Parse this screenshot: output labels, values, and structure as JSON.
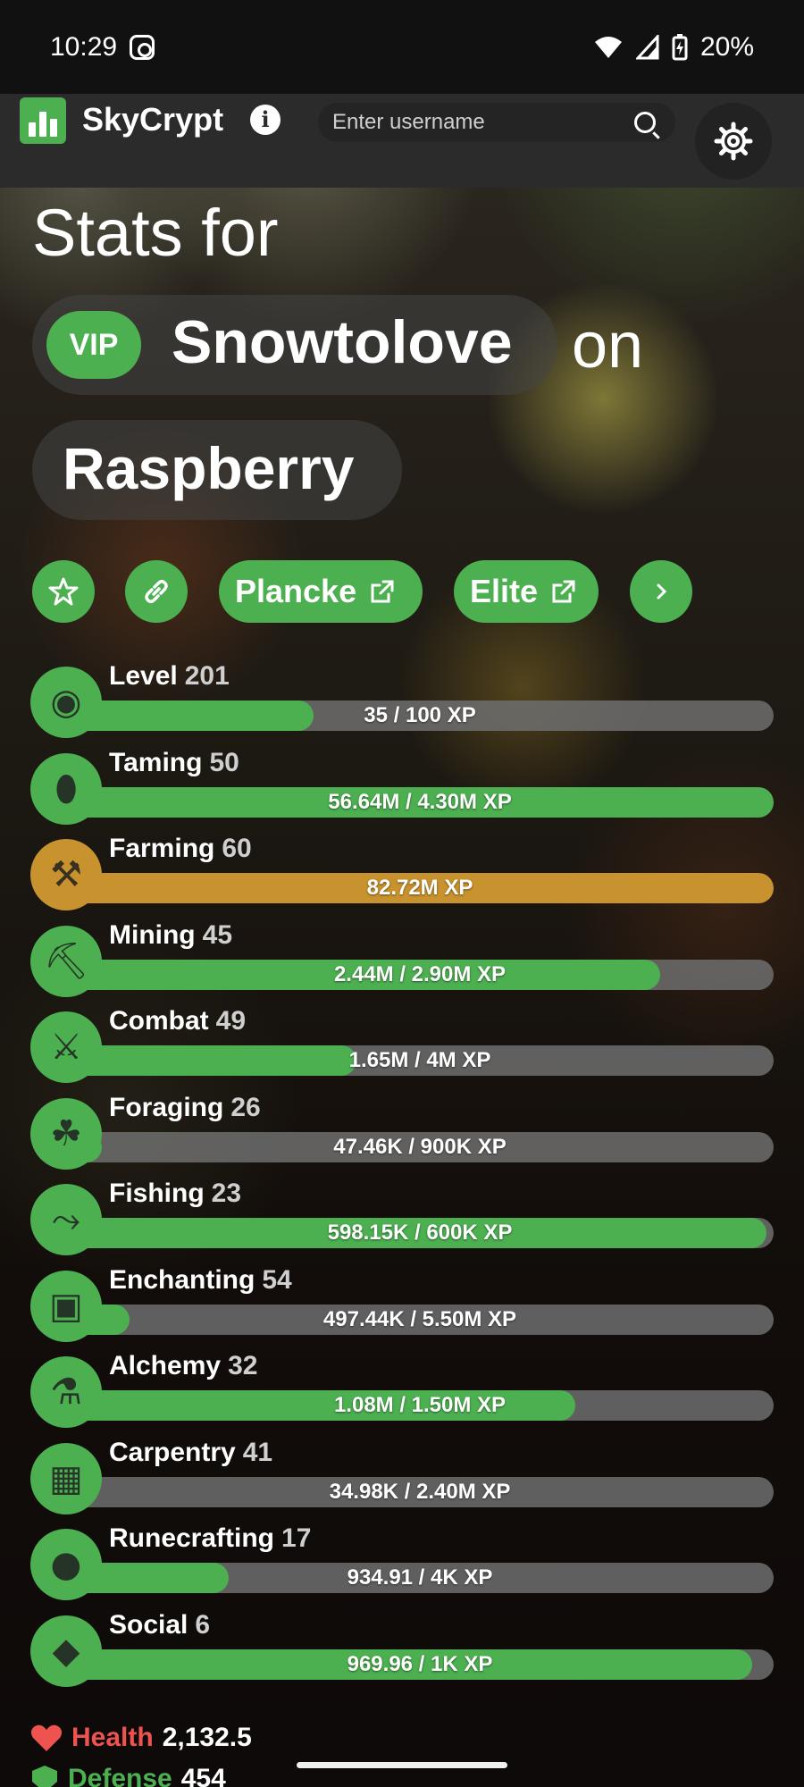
{
  "status_bar": {
    "time": "10:29",
    "battery": "20%",
    "icons": [
      "instagram-icon",
      "wifi-icon",
      "cellular-signal-icon",
      "battery-charging-icon"
    ]
  },
  "navbar": {
    "brand": "SkyCrypt",
    "search_placeholder": "Enter username",
    "icons": [
      "skycrypt-logo-icon",
      "info-icon",
      "search-icon",
      "gear-icon"
    ]
  },
  "heading": {
    "stats_for": "Stats for",
    "badge": "VIP",
    "player_name": "Snowtolove",
    "on_word": "on",
    "profile_name": "Raspberry"
  },
  "actions": {
    "plancke_label": "Plancke",
    "elite_label": "Elite",
    "icons": [
      "star-icon",
      "link-icon",
      "external-link-icon",
      "chevron-right-icon"
    ]
  },
  "skills": [
    {
      "name": "Level",
      "level": "201",
      "xp": "35 / 100 XP",
      "progress": 0.35,
      "maxed": false,
      "icon": "skyblock-level-icon"
    },
    {
      "name": "Taming",
      "level": "50",
      "xp": "56.64M / 4.30M XP",
      "progress": 1.0,
      "maxed": false,
      "icon": "spawn-egg-icon"
    },
    {
      "name": "Farming",
      "level": "60",
      "xp": "82.72M XP",
      "progress": 1.0,
      "maxed": true,
      "icon": "golden-hoe-icon"
    },
    {
      "name": "Mining",
      "level": "45",
      "xp": "2.44M / 2.90M XP",
      "progress": 0.84,
      "maxed": false,
      "icon": "pickaxe-icon"
    },
    {
      "name": "Combat",
      "level": "49",
      "xp": "1.65M / 4M XP",
      "progress": 0.41,
      "maxed": false,
      "icon": "sword-icon"
    },
    {
      "name": "Foraging",
      "level": "26",
      "xp": "47.46K / 900K XP",
      "progress": 0.05,
      "maxed": false,
      "icon": "sapling-icon"
    },
    {
      "name": "Fishing",
      "level": "23",
      "xp": "598.15K / 600K XP",
      "progress": 0.99,
      "maxed": false,
      "icon": "fishing-rod-icon"
    },
    {
      "name": "Enchanting",
      "level": "54",
      "xp": "497.44K / 5.50M XP",
      "progress": 0.09,
      "maxed": false,
      "icon": "enchanting-table-icon"
    },
    {
      "name": "Alchemy",
      "level": "32",
      "xp": "1.08M / 1.50M XP",
      "progress": 0.72,
      "maxed": false,
      "icon": "brewing-stand-icon"
    },
    {
      "name": "Carpentry",
      "level": "41",
      "xp": "34.98K / 2.40M XP",
      "progress": 0.01,
      "maxed": false,
      "icon": "crafting-table-icon"
    },
    {
      "name": "Runecrafting",
      "level": "17",
      "xp": "934.91 / 4K XP",
      "progress": 0.23,
      "maxed": false,
      "icon": "magma-cream-icon"
    },
    {
      "name": "Social",
      "level": "6",
      "xp": "969.96 / 1K XP",
      "progress": 0.97,
      "maxed": false,
      "icon": "emerald-icon"
    }
  ],
  "stats": {
    "health_label": "Health",
    "health_value": "2,132.5",
    "defense_label": "Defense",
    "defense_value": "454",
    "icons": [
      "heart-icon",
      "shield-icon"
    ]
  },
  "colors": {
    "accent": "#4caf50",
    "maxed": "#c8922e",
    "health": "#ef5350"
  }
}
